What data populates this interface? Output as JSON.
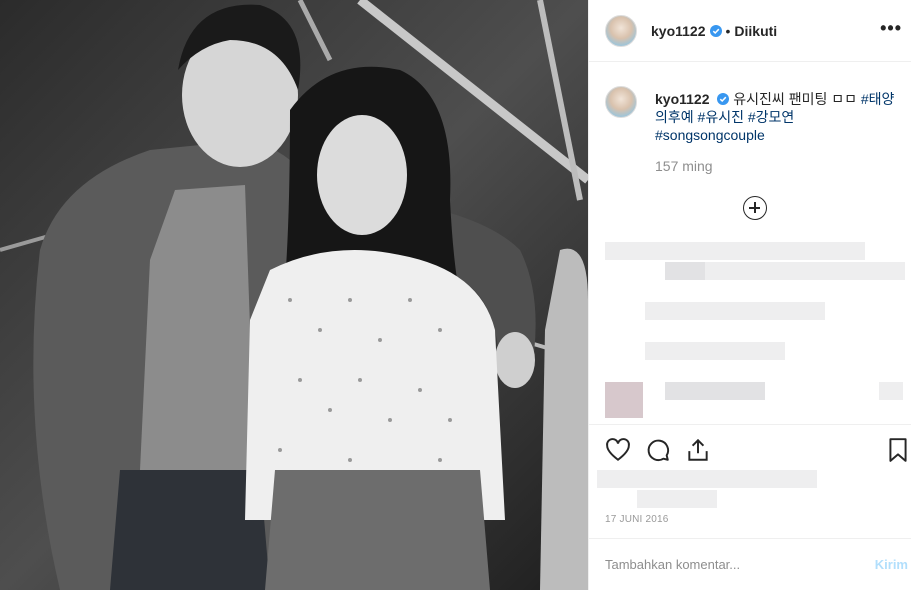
{
  "post": {
    "username": "kyo1122",
    "separator": "•",
    "follow_status": "Diikuti",
    "more_icon": "more-horizontal-icon",
    "caption": {
      "username": "kyo1122",
      "text_main": "유시진씨 팬미팅 ㅁㅁ",
      "hashtags": [
        "#태양의후예",
        "#유시진",
        "#강모연",
        "#songsongcouple"
      ]
    },
    "time_ago": "157 ming",
    "date": "17 JUNI 2016"
  },
  "comment_box": {
    "placeholder": "Tambahkan komentar...",
    "post_label": "Kirim"
  },
  "colors": {
    "hashtag": "#003569",
    "muted": "#8e8e8e",
    "verified": "#3897f0",
    "post_disabled": "#b2dffc"
  }
}
